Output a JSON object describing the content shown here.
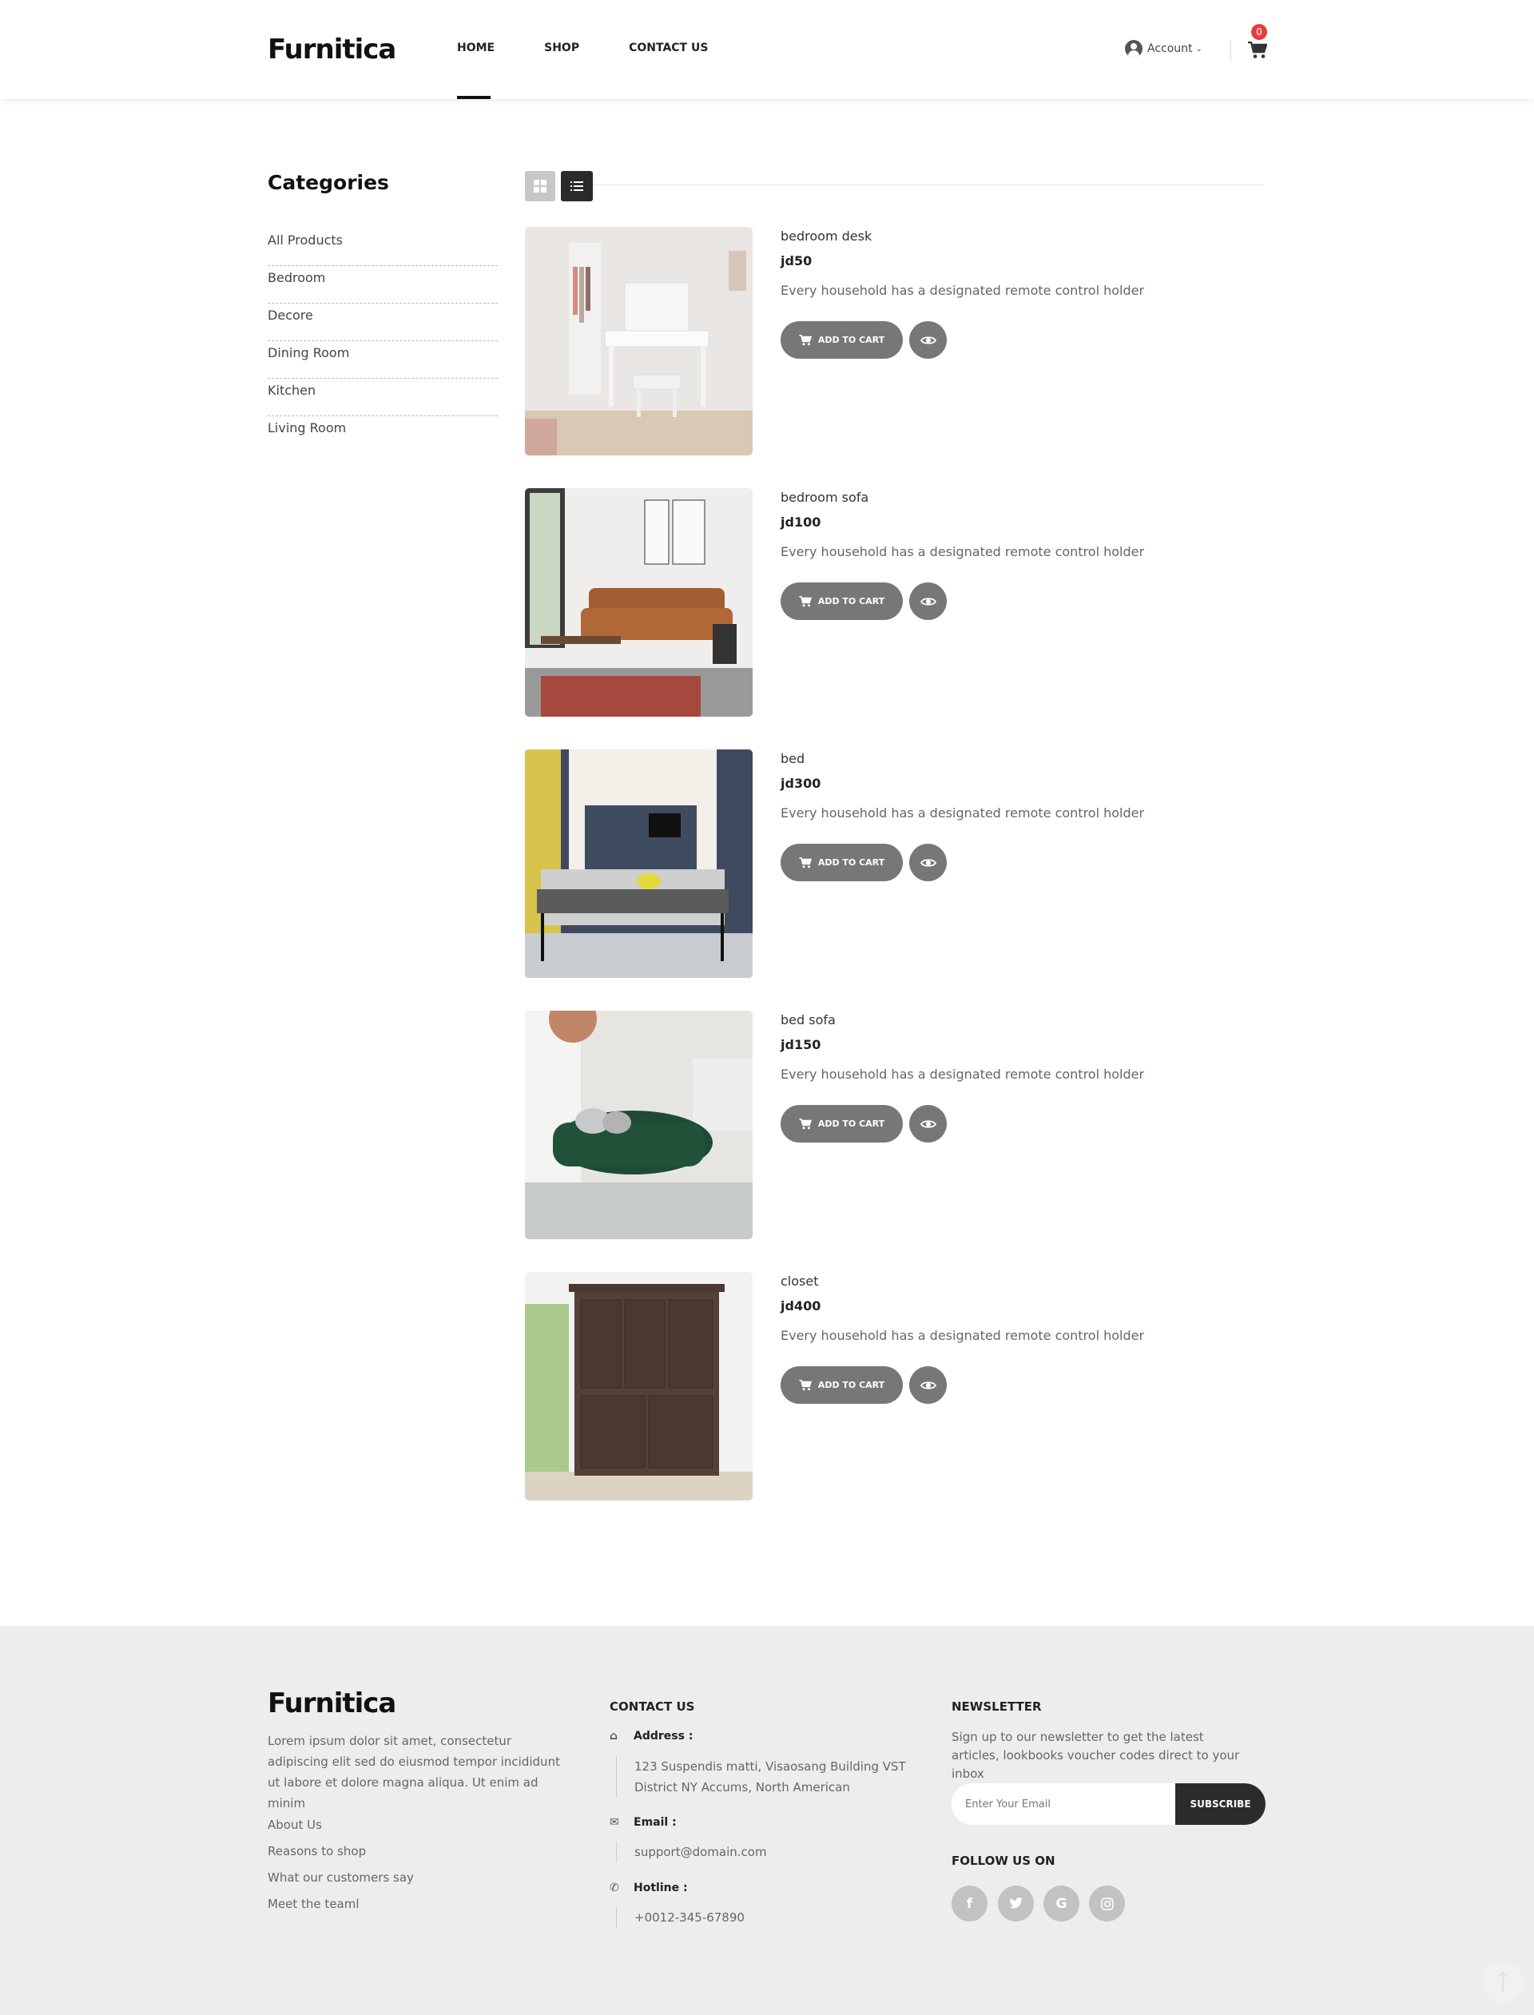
{
  "brand": {
    "logo": "Furnitica"
  },
  "nav": {
    "items": [
      "HOME",
      "SHOP",
      "CONTACT US"
    ],
    "active": "HOME"
  },
  "account": {
    "label": "Account"
  },
  "cart": {
    "count": "0"
  },
  "sidebar": {
    "title": "Categories",
    "categories": [
      "All Products",
      "Bedroom",
      "Decore",
      "Dining Room",
      "Kitchen",
      "Living Room"
    ]
  },
  "view": {
    "active": "list"
  },
  "products": [
    {
      "name": "bedroom desk",
      "price": "jd50",
      "description": "Every household has a designated remote control holder",
      "add_label": "ADD TO CART"
    },
    {
      "name": "bedroom sofa",
      "price": "jd100",
      "description": "Every household has a designated remote control holder",
      "add_label": "ADD TO CART"
    },
    {
      "name": "bed",
      "price": "jd300",
      "description": "Every household has a designated remote control holder",
      "add_label": "ADD TO CART"
    },
    {
      "name": "bed sofa",
      "price": "jd150",
      "description": "Every household has a designated remote control holder",
      "add_label": "ADD TO CART"
    },
    {
      "name": "closet",
      "price": "jd400",
      "description": "Every household has a designated remote control holder",
      "add_label": "ADD TO CART"
    }
  ],
  "footer": {
    "logo": "Furnitica",
    "about": "Lorem ipsum dolor sit amet, consectetur adipiscing elit sed do eiusmod tempor incididunt ut labore et dolore magna aliqua. Ut enim ad minim",
    "links": [
      "About Us",
      "Reasons to shop",
      "What our customers say",
      "Meet the teaml"
    ],
    "contact": {
      "heading": "CONTACT US",
      "address_label": "Address :",
      "address_line1": "123 Suspendis matti, Visaosang Building VST",
      "address_line2": "District NY Accums, North American",
      "email_label": "Email :",
      "email": "support@domain.com",
      "hotline_label": "Hotline :",
      "hotline": "+0012-345-67890"
    },
    "newsletter": {
      "heading": "NEWSLETTER",
      "text": "Sign up to our newsletter to get the latest articles, lookbooks voucher codes direct to your inbox",
      "placeholder": "Enter Your Email",
      "button": "SUBSCRIBE"
    },
    "follow": {
      "heading": "FOLLOW US ON",
      "icons": [
        "facebook-icon",
        "twitter-icon",
        "google-icon",
        "instagram-icon"
      ]
    }
  },
  "colors": {
    "accent_dark": "#2b2b2b",
    "button_gray": "#777777",
    "badge_red": "#e63e3e",
    "footer_bg": "#ededed"
  }
}
